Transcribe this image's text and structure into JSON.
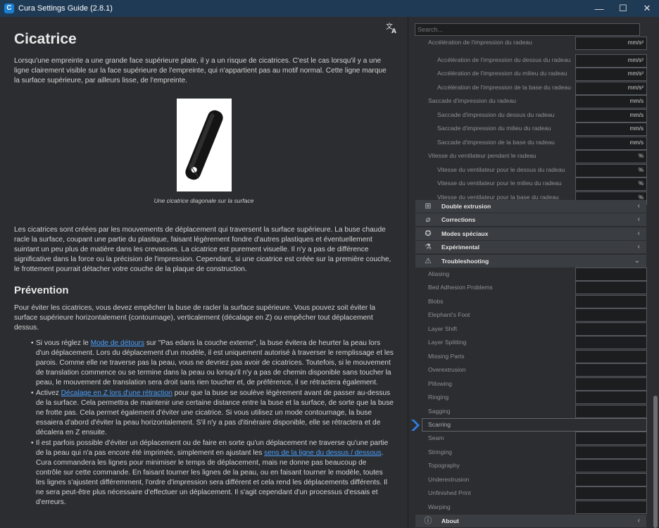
{
  "window": {
    "title": "Cura Settings Guide (2.8.1)",
    "app_icon": "C",
    "minimize": "—",
    "maximize": "☐",
    "close": "✕"
  },
  "article": {
    "title": "Cicatrice",
    "intro": "Lorsqu'une empreinte a une grande face supérieure plate, il y a un risque de cicatrices. C'est le cas lorsqu'il y a une ligne clairement visible sur la face supérieure de l'empreinte, qui n'appartient pas au motif normal. Cette ligne marque la surface supérieure, par ailleurs lisse, de l'empreinte.",
    "figure_caption": "Une cicatrice diagonale sur la surface",
    "paragraph2": "Les cicatrices sont créées par les mouvements de déplacement qui traversent la surface supérieure. La buse chaude racle la surface, coupant une partie du plastique, faisant légèrement fondre d'autres plastiques et éventuellement suintant un peu plus de matière dans les crevasses. La cicatrice est purement visuelle. Il n'y a pas de différence significative dans la force ou la précision de l'impression. Cependant, si une cicatrice est créée sur la première couche, le frottement pourrait détacher votre couche de la plaque de construction.",
    "prevention_title": "Prévention",
    "prevention_intro": "Pour éviter les cicatrices, vous devez empêcher la buse de racler la surface supérieure. Vous pouvez soit éviter la surface supérieure horizontalement (contournage), verticalement (décalage en Z) ou empêcher tout déplacement dessus.",
    "bullet1_a": "Si vous réglez le ",
    "bullet1_link": "Mode de détours",
    "bullet1_b": " sur \"Pas edans la couche externe\", la buse évitera de heurter la peau lors d'un déplacement. Lors du déplacement d'un modèle, il est uniquement autorisé à traverser le remplissage et les parois. Comme elle ne traverse pas la peau, vous ne devriez pas avoir de cicatrices. Toutefois, si le mouvement de translation commence ou se termine dans la peau ou lorsqu'il n'y a pas de chemin disponible sans toucher la peau, le mouvement de translation sera droit sans rien toucher et, de préférence, il se rétractera également.",
    "bullet2_a": "Activez ",
    "bullet2_link": "Décalage en Z lors d'une rétraction",
    "bullet2_b": " pour que la buse se soulève légèrement avant de passer au-dessus de la surface. Cela permettra de maintenir une certaine distance entre la buse et la surface, de sorte que la buse ne frotte pas. Cela permet également d'éviter une cicatrice. Si vous utilisez un mode contournage, la buse essaiera d'abord d'éviter la peau horizontalement. S'il n'y a pas d'itinéraire disponible, elle se rétractera et de décalera en Z ensuite.",
    "bullet3_a": "Il est parfois possible d'éviter un déplacement ou de faire en sorte qu'un déplacement ne traverse qu'une partie de la peau qui n'a pas encore été imprimée, simplement en ajustant les ",
    "bullet3_link": "sens de la ligne du dessus / dessous",
    "bullet3_b": ". Cura commandera les lignes pour minimiser le temps de déplacement, mais ne donne pas beaucoup de contrôle sur cette commande. En faisant tourner les lignes de la peau, ou en faisant tourner le modèle, toutes les lignes s'ajustent différemment, l'ordre d'impression sera différent et cela rend les déplacements différents. Il ne sera peut-être plus nécessaire d'effectuer un déplacement. Il s'agit cependant d'un processus d'essais et d'erreurs."
  },
  "panel": {
    "search_placeholder": "Search...",
    "settings": [
      {
        "label": "Accélération de l'impression du radeau",
        "unit": "mm/s²",
        "indent": 1
      },
      {
        "label": "Accélération de l'impression du dessus du radeau",
        "unit": "mm/s²",
        "indent": 2
      },
      {
        "label": "Accélération de l'impression du milieu du radeau",
        "unit": "mm/s²",
        "indent": 2
      },
      {
        "label": "Accélération de l'impression de la base du radeau",
        "unit": "mm/s²",
        "indent": 2
      },
      {
        "label": "Saccade d'impression du radeau",
        "unit": "mm/s",
        "indent": 1
      },
      {
        "label": "Saccade d'impression du dessus du radeau",
        "unit": "mm/s",
        "indent": 2
      },
      {
        "label": "Saccade d'impression du milieu du radeau",
        "unit": "mm/s",
        "indent": 2
      },
      {
        "label": "Saccade d'impression de la base du radeau",
        "unit": "mm/s",
        "indent": 2
      },
      {
        "label": "Vitesse du ventilateur pendant le radeau",
        "unit": "%",
        "indent": 1
      },
      {
        "label": "Vitesse du ventilateur pour le dessus du radeau",
        "unit": "%",
        "indent": 2
      },
      {
        "label": "Vitesse du ventilateur pour le milieu du radeau",
        "unit": "%",
        "indent": 2
      },
      {
        "label": "Vitesse du ventilateur pour la base du radeau",
        "unit": "%",
        "indent": 2
      }
    ],
    "categories": [
      {
        "label": "Double extrusion",
        "icon": "dual-extrusion-icon",
        "glyph": "⊞",
        "chevron": "‹"
      },
      {
        "label": "Corrections",
        "icon": "corrections-icon",
        "glyph": "⌀",
        "chevron": "‹"
      },
      {
        "label": "Modes spéciaux",
        "icon": "star-icon",
        "glyph": "✪",
        "chevron": "‹"
      },
      {
        "label": "Expérimental",
        "icon": "flask-icon",
        "glyph": "⚗",
        "chevron": "‹"
      },
      {
        "label": "Troubleshooting",
        "icon": "warning-icon",
        "glyph": "⚠",
        "chevron": "⌄"
      }
    ],
    "troubleshooting": [
      "Aliasing",
      "Bed Adhesion Problems",
      "Blobs",
      "Elephant's Foot",
      "Layer Shift",
      "Layer Splitting",
      "Missing Parts",
      "Overextrusion",
      "Pillowing",
      "Ringing",
      "Sagging",
      "Scarring",
      "Seam",
      "Stringing",
      "Topography",
      "Underextrusion",
      "Unfinished Print",
      "Warping"
    ],
    "active_item": "Scarring",
    "about": {
      "label": "About",
      "glyph": "ⓘ",
      "chevron": "‹"
    },
    "accent_color": "#2d7fe0"
  }
}
